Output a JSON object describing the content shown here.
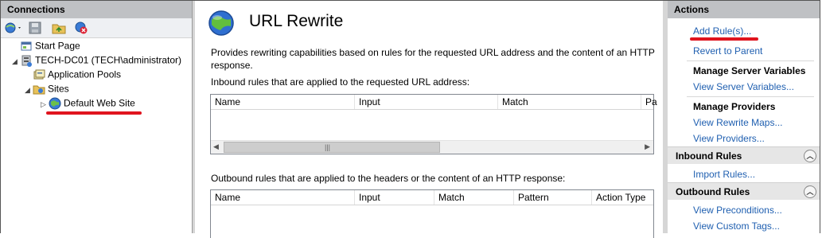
{
  "connections": {
    "header": "Connections",
    "toolbar": [
      "connect-icon",
      "save-icon",
      "folder-up-icon",
      "disconnect-icon"
    ],
    "tree": [
      {
        "label": "Start Page",
        "icon": "start-page-icon"
      },
      {
        "label": "TECH-DC01 (TECH\\administrator)",
        "icon": "server-icon"
      },
      {
        "label": "Application Pools",
        "icon": "app-pools-icon"
      },
      {
        "label": "Sites",
        "icon": "sites-folder-icon"
      },
      {
        "label": "Default Web Site",
        "icon": "globe-icon"
      }
    ]
  },
  "main": {
    "title": "URL Rewrite",
    "description": "Provides rewriting capabilities based on rules for the requested URL address and the content of an HTTP response.",
    "inbound_label": "Inbound rules that are applied to the requested URL address:",
    "inbound_columns": [
      "Name",
      "Input",
      "Match",
      "Pa"
    ],
    "outbound_label": "Outbound rules that are applied to the headers or the content of an HTTP response:",
    "outbound_columns": [
      "Name",
      "Input",
      "Match",
      "Pattern",
      "Action Type"
    ]
  },
  "actions": {
    "header": "Actions",
    "add_rules": "Add Rule(s)...",
    "revert": "Revert to Parent",
    "manage_server_vars": "Manage Server Variables",
    "view_server_vars": "View Server Variables...",
    "manage_providers": "Manage Providers",
    "view_rewrite_maps": "View Rewrite Maps...",
    "view_providers": "View Providers...",
    "inbound_rules": "Inbound Rules",
    "import_rules": "Import Rules...",
    "outbound_rules": "Outbound Rules",
    "view_preconditions": "View Preconditions...",
    "view_custom_tags": "View Custom Tags..."
  },
  "colors": {
    "link": "#1f5fb0",
    "highlight": "#e0141e"
  }
}
